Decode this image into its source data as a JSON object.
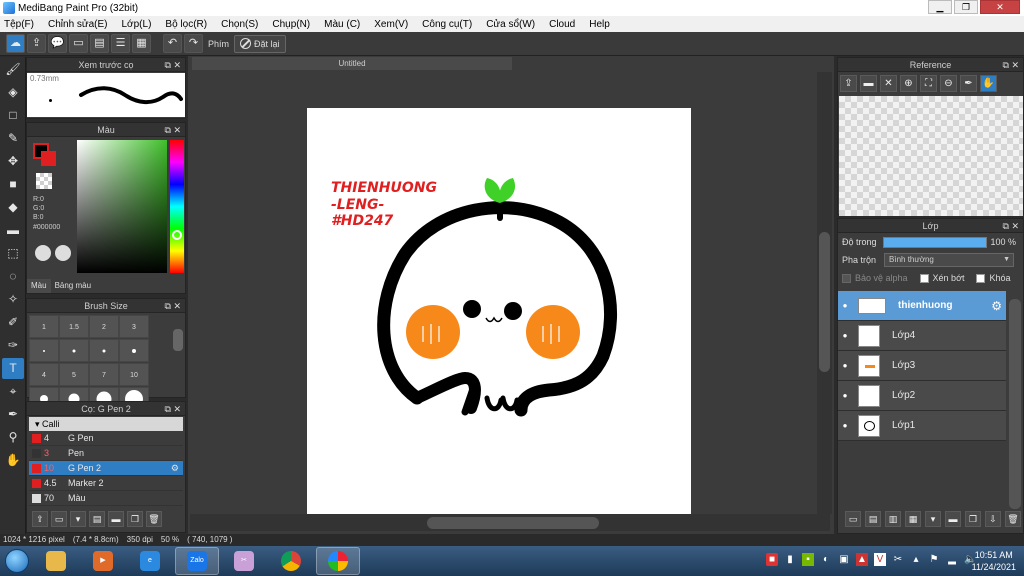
{
  "window": {
    "title": "MediBang Paint Pro (32bit)",
    "minimize": "▁",
    "maximize": "❐",
    "close": "✕"
  },
  "menu": [
    "Tệp(F)",
    "Chỉnh sửa(E)",
    "Lớp(L)",
    "Bộ lọc(R)",
    "Chọn(S)",
    "Chụp(N)",
    "Màu (C)",
    "Xem(V)",
    "Công cụ(T)",
    "Cửa sổ(W)",
    "Cloud",
    "Help"
  ],
  "toolbar": {
    "shortcut_label": "Phím",
    "reset_label": "Đặt lại"
  },
  "brush_preview": {
    "title": "Xem trước cọ",
    "size": "0.73mm"
  },
  "color_panel": {
    "title": "Màu",
    "r": "R:0",
    "g": "G:0",
    "b": "B:0",
    "hex": "#000000",
    "tab_color": "Màu",
    "tab_palette": "Bảng màu"
  },
  "brush_size": {
    "title": "Brush Size",
    "rows": [
      [
        "1",
        "1.5",
        "2",
        "3"
      ],
      [
        "",
        "",
        "",
        ""
      ],
      [
        "4",
        "5",
        "7",
        "10"
      ],
      [
        "",
        "",
        "",
        ""
      ]
    ]
  },
  "brush_list": {
    "title": "Cọ: G Pen 2",
    "group": "Calli",
    "items": [
      {
        "size": "4",
        "name": "G Pen",
        "color": "#e02020"
      },
      {
        "size": "3",
        "name": "Pen",
        "color": "#333333"
      },
      {
        "size": "10",
        "name": "G Pen 2",
        "color": "#e02020",
        "selected": true
      },
      {
        "size": "4.5",
        "name": "Marker 2",
        "color": "#e02020"
      },
      {
        "size": "70",
        "name": "Màu",
        "color": "#dddddd"
      }
    ]
  },
  "document": {
    "tab": "Untitled",
    "watermark": [
      "THIENHUONG",
      "-LENG-",
      "#HD247"
    ]
  },
  "reference": {
    "title": "Reference"
  },
  "layers": {
    "title": "Lớp",
    "opacity_label": "Độ trong",
    "opacity_value": "100 %",
    "opacity": 1.0,
    "blend_label": "Pha trộn",
    "blend_value": "Bình thường",
    "protect_alpha": "Bảo vệ alpha",
    "clipping": "Xén bớt",
    "lock": "Khóa",
    "items": [
      {
        "name": "thienhuong",
        "selected": true
      },
      {
        "name": "Lớp4"
      },
      {
        "name": "Lớp3"
      },
      {
        "name": "Lớp2"
      },
      {
        "name": "Lớp1"
      }
    ]
  },
  "status": {
    "size": "1024 * 1216 pixel",
    "physical": "(7.4 * 8.8cm)",
    "dpi": "350 dpi",
    "zoom": "50 %",
    "cursor": "( 740, 1079 )"
  },
  "taskbar": {
    "time": "10:51 AM",
    "date": "11/24/2021"
  },
  "colors": {
    "accent": "#2f7ec4",
    "brush_red": "#e02020",
    "sprout_green": "#3fd128",
    "cheek_orange": "#f7891a"
  }
}
